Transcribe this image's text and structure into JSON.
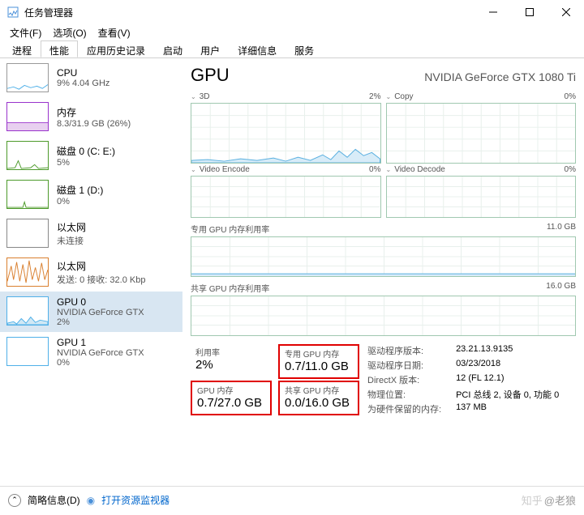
{
  "window": {
    "title": "任务管理器"
  },
  "menu": {
    "file": "文件(F)",
    "options": "选项(O)",
    "view": "查看(V)"
  },
  "tabs": [
    "进程",
    "性能",
    "应用历史记录",
    "启动",
    "用户",
    "详细信息",
    "服务"
  ],
  "active_tab": 1,
  "sidebar": [
    {
      "name": "CPU",
      "sub": "9%  4.04 GHz",
      "color": "#4fb0e8"
    },
    {
      "name": "内存",
      "sub": "8.3/31.9 GB (26%)",
      "color": "#9933cc"
    },
    {
      "name": "磁盘 0 (C: E:)",
      "sub": "5%",
      "color": "#4c9a2a"
    },
    {
      "name": "磁盘 1 (D:)",
      "sub": "0%",
      "color": "#4c9a2a"
    },
    {
      "name": "以太网",
      "sub": "未连接",
      "color": "#888"
    },
    {
      "name": "以太网",
      "sub": "发送: 0  接收: 32.0 Kbp",
      "color": "#d97f2e"
    },
    {
      "name": "GPU 0",
      "sub": "NVIDIA GeForce GTX",
      "sub2": "2%",
      "selected": true,
      "color": "#4fb0e8"
    },
    {
      "name": "GPU 1",
      "sub": "NVIDIA GeForce GTX",
      "sub2": "0%",
      "color": "#4fb0e8"
    }
  ],
  "main": {
    "title": "GPU",
    "gpu_name": "NVIDIA GeForce GTX 1080 Ti",
    "panels": {
      "p3d": {
        "label": "3D",
        "pct": "2%"
      },
      "copy": {
        "label": "Copy",
        "pct": "0%"
      },
      "venc": {
        "label": "Video Encode",
        "pct": "0%"
      },
      "vdec": {
        "label": "Video Decode",
        "pct": "0%"
      }
    },
    "dedicated_section": {
      "label": "专用 GPU 内存利用率",
      "max": "11.0 GB"
    },
    "shared_section": {
      "label": "共享 GPU 内存利用率",
      "max": "16.0 GB"
    },
    "stats": {
      "util": {
        "label": "利用率",
        "value": "2%"
      },
      "gpu_mem": {
        "label": "GPU 内存",
        "value": "0.7/27.0 GB"
      },
      "ded_mem": {
        "label": "专用 GPU 内存",
        "value": "0.7/11.0 GB"
      },
      "shr_mem": {
        "label": "共享 GPU 内存",
        "value": "0.0/16.0 GB"
      }
    },
    "info": {
      "driver_ver_k": "驱动程序版本:",
      "driver_ver_v": "23.21.13.9135",
      "driver_date_k": "驱动程序日期:",
      "driver_date_v": "03/23/2018",
      "dx_k": "DirectX 版本:",
      "dx_v": "12 (FL 12.1)",
      "loc_k": "物理位置:",
      "loc_v": "PCI 总线 2, 设备 0, 功能 0",
      "reserved_k": "为硬件保留的内存:",
      "reserved_v": "137 MB"
    }
  },
  "footer": {
    "brief": "简略信息(D)",
    "monitor": "打开资源监视器"
  },
  "watermark": "@老狼"
}
